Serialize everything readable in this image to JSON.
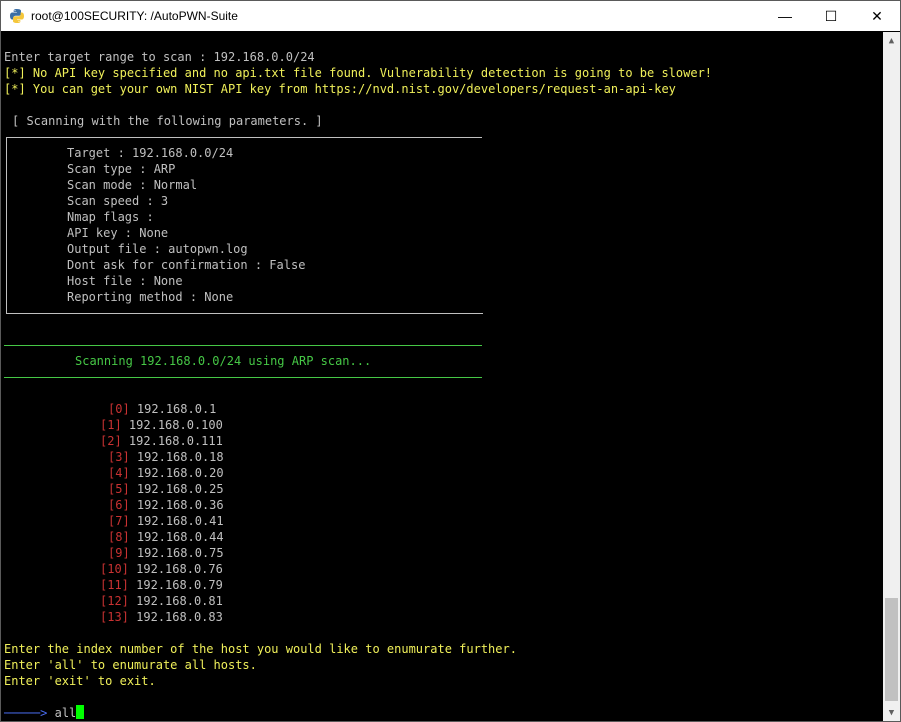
{
  "window": {
    "title": "root@100SECURITY: /AutoPWN-Suite",
    "minimize": "—",
    "maximize": "☐",
    "close": "✕"
  },
  "icons": {
    "app": "python-icon",
    "scroll_up": "triangle-up-icon",
    "scroll_down": "triangle-down-icon"
  },
  "colors": {
    "yellow": "#f0f05a",
    "green": "#46c846",
    "red": "#c83232",
    "text": "#c0c0c0"
  },
  "terminal": {
    "prompt_line": "Enter target range to scan : 192.168.0.0/24",
    "warn1_prefix": "[*]",
    "warn1_text": " No API key specified and no api.txt file found. Vulnerability detection is going to be slower!",
    "warn2_prefix": "[*]",
    "warn2_text": " You can get your own NIST API key from https://nvd.nist.gov/developers/request-an-api-key",
    "params_title": "[ Scanning with the following parameters. ]",
    "params": [
      "Target : 192.168.0.0/24",
      "Scan type : ARP",
      "Scan mode : Normal",
      "Scan speed : 3",
      "Nmap flags :",
      "API key : None",
      "Output file : autopwn.log",
      "Dont ask for confirmation : False",
      "Host file : None",
      "Reporting method : None"
    ],
    "scan_banner": "Scanning 192.168.0.0/24 using ARP scan...",
    "hosts": [
      {
        "idx": "[0]",
        "ip": "192.168.0.1"
      },
      {
        "idx": "[1]",
        "ip": "192.168.0.100"
      },
      {
        "idx": "[2]",
        "ip": "192.168.0.111"
      },
      {
        "idx": "[3]",
        "ip": "192.168.0.18"
      },
      {
        "idx": "[4]",
        "ip": "192.168.0.20"
      },
      {
        "idx": "[5]",
        "ip": "192.168.0.25"
      },
      {
        "idx": "[6]",
        "ip": "192.168.0.36"
      },
      {
        "idx": "[7]",
        "ip": "192.168.0.41"
      },
      {
        "idx": "[8]",
        "ip": "192.168.0.44"
      },
      {
        "idx": "[9]",
        "ip": "192.168.0.75"
      },
      {
        "idx": "[10]",
        "ip": "192.168.0.76"
      },
      {
        "idx": "[11]",
        "ip": "192.168.0.79"
      },
      {
        "idx": "[12]",
        "ip": "192.168.0.81"
      },
      {
        "idx": "[13]",
        "ip": "192.168.0.83"
      }
    ],
    "instr1": "Enter the index number of the host you would like to enumurate further.",
    "instr2": "Enter 'all' to enumurate all hosts.",
    "instr3": "Enter 'exit' to exit.",
    "input_prompt": "─────>",
    "input_value": "all"
  }
}
